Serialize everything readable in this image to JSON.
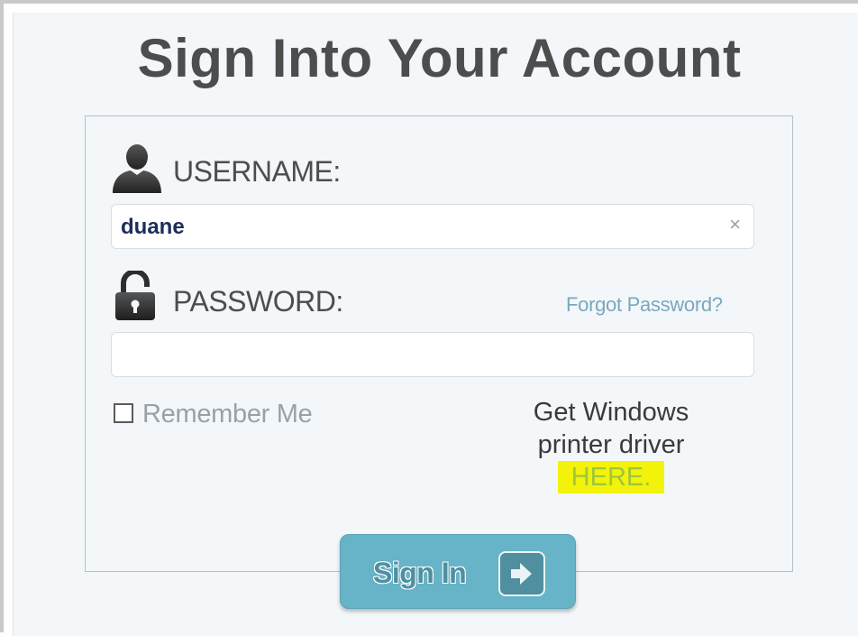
{
  "page": {
    "title": "Sign Into Your Account"
  },
  "form": {
    "username_label": "USERNAME:",
    "username_value": "duane",
    "clear_symbol": "×",
    "password_label": "PASSWORD:",
    "password_value": "",
    "forgot_password": "Forgot Password?",
    "remember_me_label": "Remember Me",
    "remember_me_checked": false,
    "driver_line1": "Get Windows",
    "driver_line2": "printer driver",
    "driver_link": "HERE.",
    "sign_in_label": "Sign In"
  },
  "icons": {
    "user": "user-silhouette-icon",
    "lock": "padlock-open-icon",
    "clear": "close-icon",
    "arrow": "arrow-right-icon"
  },
  "colors": {
    "title": "#4d4d4d",
    "link": "#79a8bc",
    "highlight": "#f2f20a",
    "highlight_text": "#9fc63a",
    "button": "#67b3c7",
    "button_dark": "#4f8fa0",
    "background": "#f3f7fa"
  }
}
